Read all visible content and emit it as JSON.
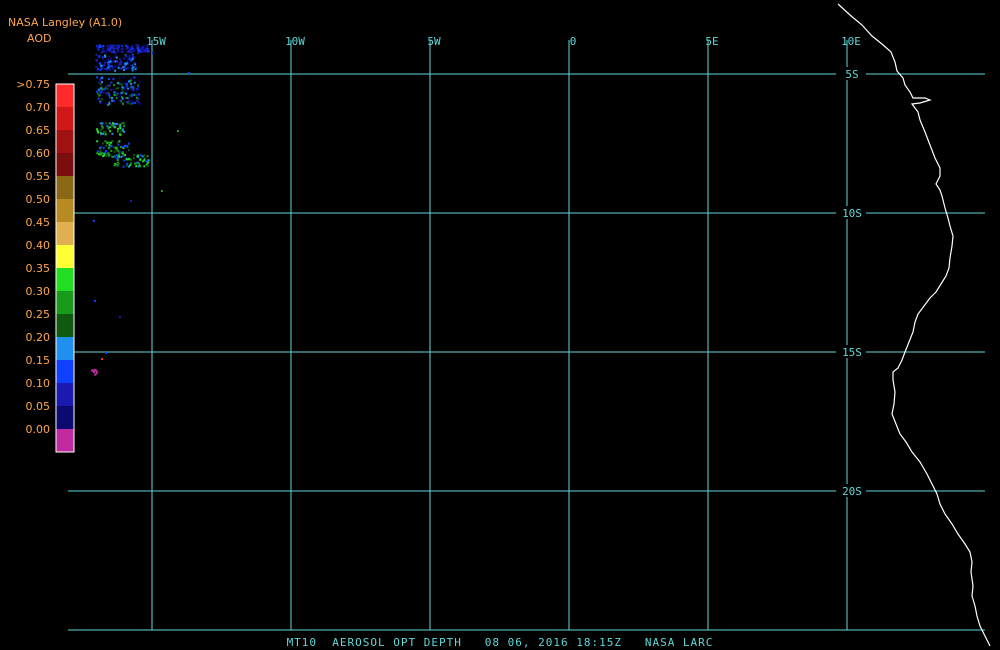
{
  "header": {
    "source_label": "NASA Langley (A1.0)",
    "variable_label": "AOD"
  },
  "legend": {
    "items": [
      {
        "label": ">0.75",
        "color": "#ff2a2a"
      },
      {
        "label": "0.70",
        "color": "#d01818"
      },
      {
        "label": "0.65",
        "color": "#a01212"
      },
      {
        "label": "0.60",
        "color": "#7a0d0d"
      },
      {
        "label": "0.55",
        "color": "#8b6914"
      },
      {
        "label": "0.50",
        "color": "#b88a22"
      },
      {
        "label": "0.45",
        "color": "#e0b050"
      },
      {
        "label": "0.40",
        "color": "#ffff33"
      },
      {
        "label": "0.35",
        "color": "#22dd22"
      },
      {
        "label": "0.30",
        "color": "#1a9a1a"
      },
      {
        "label": "0.25",
        "color": "#0f5a0f"
      },
      {
        "label": "0.20",
        "color": "#2090f0"
      },
      {
        "label": "0.15",
        "color": "#1040ff"
      },
      {
        "label": "0.10",
        "color": "#1a1ab0"
      },
      {
        "label": "0.05",
        "color": "#0a0a70"
      },
      {
        "label": "0.00",
        "color": "#c02aa0"
      }
    ]
  },
  "map": {
    "grid_color": "#5fd7d7",
    "coastline_color": "#ffffff",
    "longitude_labels": [
      "15W",
      "10W",
      "5W",
      "0",
      "5E",
      "10E"
    ],
    "latitude_labels": [
      "5S",
      "10S",
      "15S",
      "20S"
    ]
  },
  "footer": {
    "caption": "MT10  AEROSOL OPT DEPTH   08 06, 2016 18:15Z   NASA LARC"
  }
}
